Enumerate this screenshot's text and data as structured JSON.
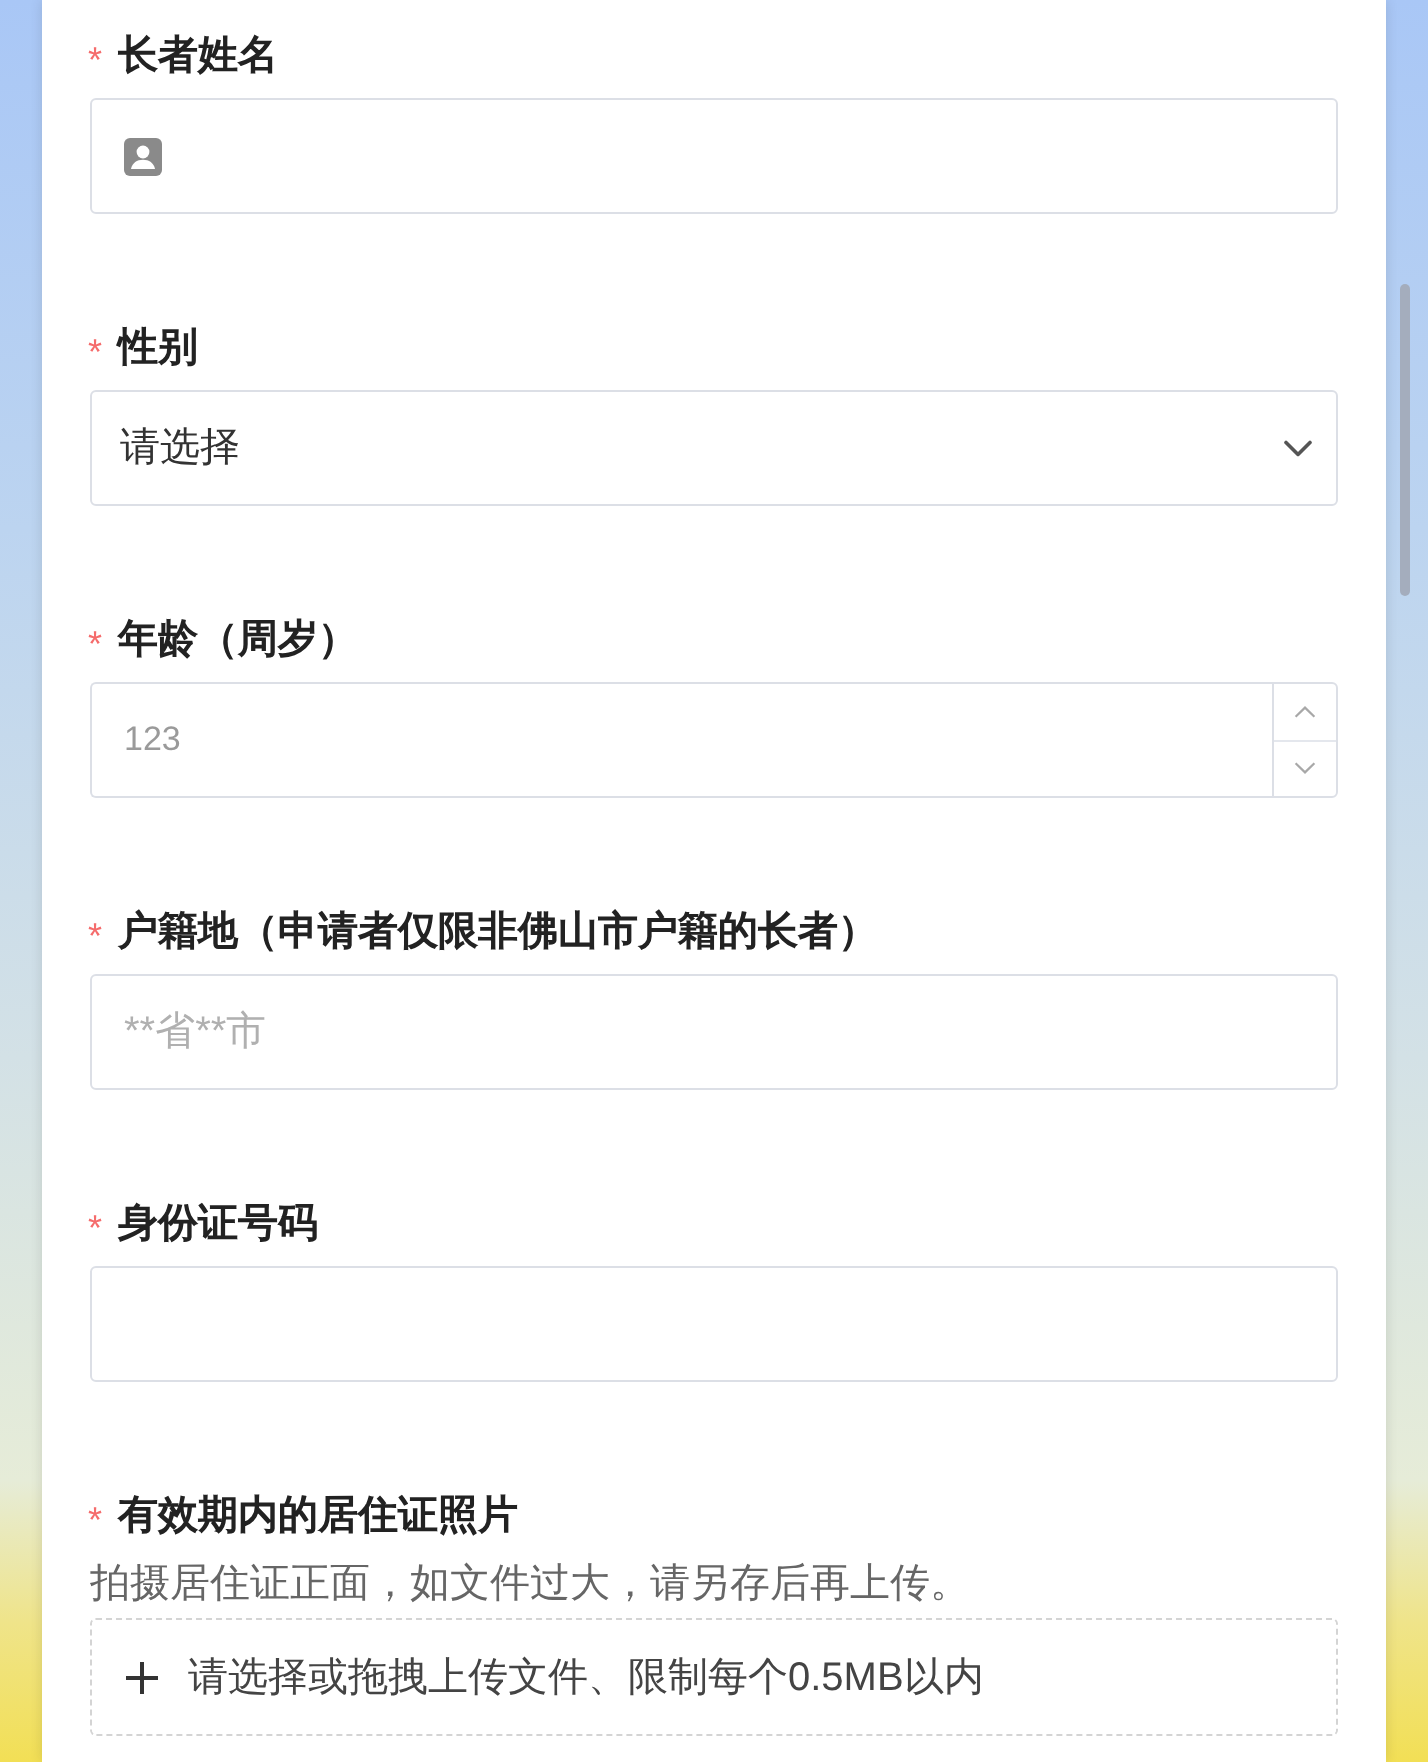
{
  "form": {
    "fields": [
      {
        "kind": "person",
        "label": "长者姓名",
        "required_mark": "*"
      },
      {
        "kind": "select",
        "label": "性别",
        "required_mark": "*",
        "value": "请选择"
      },
      {
        "kind": "number",
        "label": "年龄（周岁）",
        "required_mark": "*",
        "placeholder": "123"
      },
      {
        "kind": "text",
        "label": "户籍地（申请者仅限非佛山市户籍的长者）",
        "required_mark": "*",
        "placeholder": "**省**市"
      },
      {
        "kind": "text",
        "label": "身份证号码",
        "required_mark": "*"
      },
      {
        "kind": "upload",
        "label": "有效期内的居住证照片",
        "required_mark": "*",
        "hint": "拍摄居住证正面，如文件过大，请另存后再上传。",
        "upload_text": "请选择或拖拽上传文件、限制每个0.5MB以内"
      }
    ]
  }
}
